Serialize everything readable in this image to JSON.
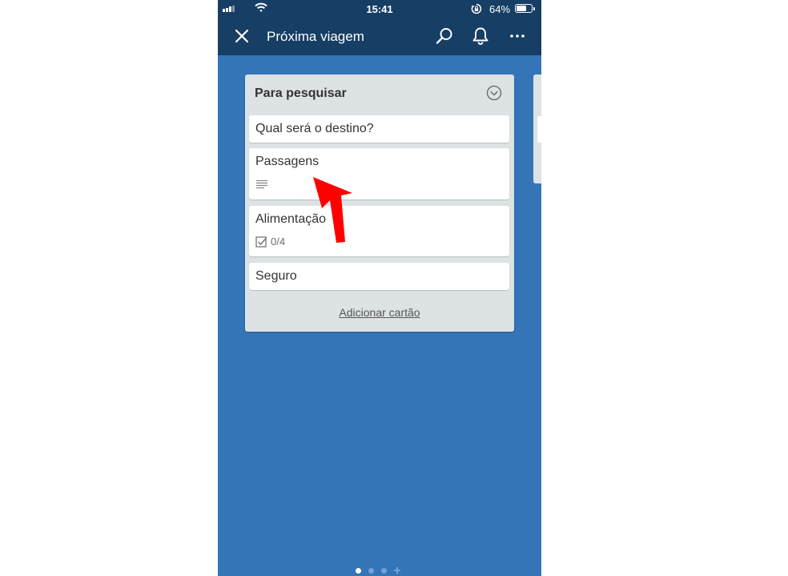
{
  "status_bar": {
    "time": "15:41",
    "battery_percent": "64%",
    "battery_level": 0.64,
    "icons": [
      "signal-icon",
      "wifi-icon",
      "rotation-lock-icon",
      "battery-icon"
    ]
  },
  "app_bar": {
    "title": "Próxima viagem",
    "icons": [
      "close-icon",
      "search-icon",
      "bell-icon",
      "more-icon"
    ],
    "color": "#173e64"
  },
  "board": {
    "background_color": "#3475b8",
    "list": {
      "title": "Para pesquisar",
      "menu_icon": "chevron-down-circle-icon",
      "cards": [
        {
          "name": "Qual será o destino?"
        },
        {
          "name": "Passagens",
          "badge_icon": "description-icon"
        },
        {
          "name": "Alimentação",
          "badge_icon": "checklist-icon",
          "checklist": "0/4"
        },
        {
          "name": "Seguro"
        }
      ],
      "add_card_label": "Adicionar cartão"
    },
    "page_indicator": {
      "pages": 3,
      "active": 1,
      "has_add": true
    }
  },
  "annotation": {
    "icon": "red-arrow-icon",
    "color": "#ff0000"
  }
}
